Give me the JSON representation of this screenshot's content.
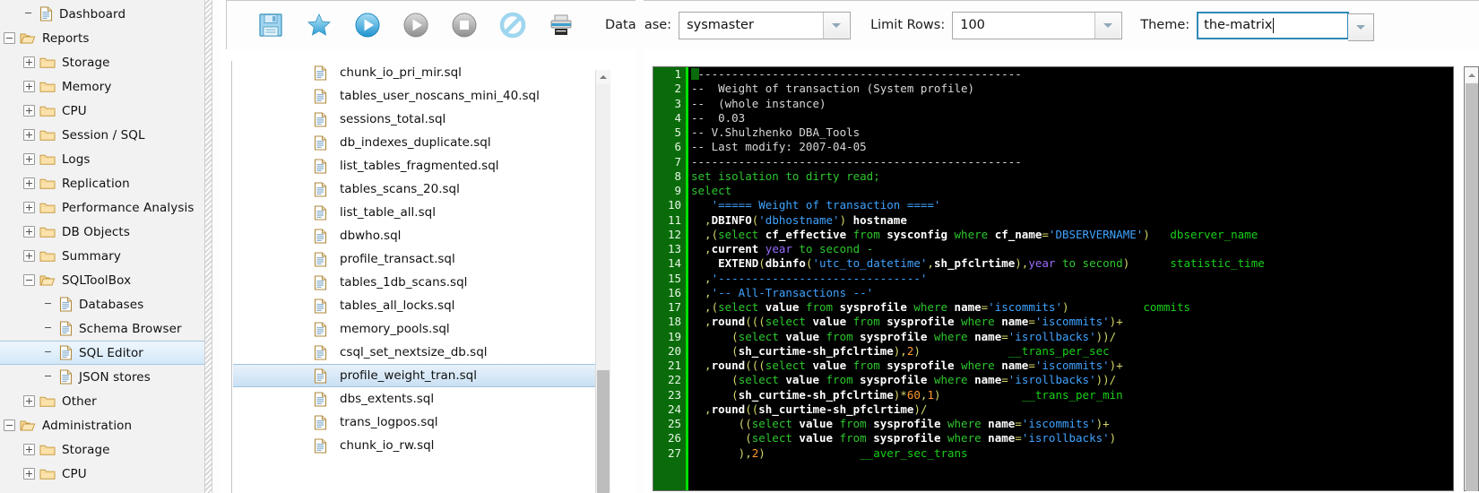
{
  "sidebar": {
    "items": [
      {
        "label": "Dashboard",
        "icon": "document-icon",
        "indent": 1,
        "expander": "none",
        "selected": false
      },
      {
        "label": "Reports",
        "icon": "folder-open-icon",
        "indent": 0,
        "expander": "minus",
        "selected": false
      },
      {
        "label": "Storage",
        "icon": "folder-icon",
        "indent": 1,
        "expander": "plus",
        "selected": false
      },
      {
        "label": "Memory",
        "icon": "folder-icon",
        "indent": 1,
        "expander": "plus",
        "selected": false
      },
      {
        "label": "CPU",
        "icon": "folder-icon",
        "indent": 1,
        "expander": "plus",
        "selected": false
      },
      {
        "label": "Session / SQL",
        "icon": "folder-icon",
        "indent": 1,
        "expander": "plus",
        "selected": false
      },
      {
        "label": "Logs",
        "icon": "folder-icon",
        "indent": 1,
        "expander": "plus",
        "selected": false
      },
      {
        "label": "Replication",
        "icon": "folder-icon",
        "indent": 1,
        "expander": "plus",
        "selected": false
      },
      {
        "label": "Performance Analysis",
        "icon": "folder-icon",
        "indent": 1,
        "expander": "plus",
        "selected": false
      },
      {
        "label": "DB Objects",
        "icon": "folder-icon",
        "indent": 1,
        "expander": "plus",
        "selected": false
      },
      {
        "label": "Summary",
        "icon": "folder-icon",
        "indent": 1,
        "expander": "plus",
        "selected": false
      },
      {
        "label": "SQLToolBox",
        "icon": "folder-open-icon",
        "indent": 1,
        "expander": "minus",
        "selected": false
      },
      {
        "label": "Databases",
        "icon": "document-icon",
        "indent": 2,
        "expander": "none",
        "selected": false
      },
      {
        "label": "Schema Browser",
        "icon": "document-icon",
        "indent": 2,
        "expander": "none",
        "selected": false
      },
      {
        "label": "SQL Editor",
        "icon": "document-icon",
        "indent": 2,
        "expander": "none",
        "selected": true
      },
      {
        "label": "JSON stores",
        "icon": "document-icon",
        "indent": 2,
        "expander": "none",
        "selected": false
      },
      {
        "label": "Other",
        "icon": "folder-icon",
        "indent": 1,
        "expander": "plus",
        "selected": false
      },
      {
        "label": "Administration",
        "icon": "folder-open-icon",
        "indent": 0,
        "expander": "minus",
        "selected": false
      },
      {
        "label": "Storage",
        "icon": "folder-icon",
        "indent": 1,
        "expander": "plus",
        "selected": false
      },
      {
        "label": "CPU",
        "icon": "folder-icon",
        "indent": 1,
        "expander": "plus",
        "selected": false
      }
    ]
  },
  "toolbar": {
    "buttons": [
      {
        "name": "save-icon",
        "title": "Save"
      },
      {
        "name": "favorite-star-icon",
        "title": "Favorite"
      },
      {
        "name": "run-icon",
        "title": "Run"
      },
      {
        "name": "run-step-icon",
        "title": "Run step"
      },
      {
        "name": "stop-icon",
        "title": "Stop"
      },
      {
        "name": "cancel-icon",
        "title": "Cancel"
      },
      {
        "name": "print-icon",
        "title": "Print"
      }
    ],
    "database": {
      "label": "Database:",
      "value": "sysmaster"
    },
    "limit_rows": {
      "label": "Limit Rows:",
      "value": "100"
    },
    "theme": {
      "label": "Theme:",
      "value": "the-matrix",
      "focused": true
    }
  },
  "filelist": {
    "files": [
      {
        "name": "chunk_io_pri_mir.sql",
        "selected": false
      },
      {
        "name": "tables_user_noscans_mini_40.sql",
        "selected": false
      },
      {
        "name": "sessions_total.sql",
        "selected": false
      },
      {
        "name": "db_indexes_duplicate.sql",
        "selected": false
      },
      {
        "name": "list_tables_fragmented.sql",
        "selected": false
      },
      {
        "name": "tables_scans_20.sql",
        "selected": false
      },
      {
        "name": "list_table_all.sql",
        "selected": false
      },
      {
        "name": "dbwho.sql",
        "selected": false
      },
      {
        "name": "profile_transact.sql",
        "selected": false
      },
      {
        "name": "tables_1db_scans.sql",
        "selected": false
      },
      {
        "name": "tables_all_locks.sql",
        "selected": false
      },
      {
        "name": "memory_pools.sql",
        "selected": false
      },
      {
        "name": "csql_set_nextsize_db.sql",
        "selected": false
      },
      {
        "name": "profile_weight_tran.sql",
        "selected": true
      },
      {
        "name": "dbs_extents.sql",
        "selected": false
      },
      {
        "name": "trans_logpos.sql",
        "selected": false
      },
      {
        "name": "chunk_io_rw.sql",
        "selected": false
      }
    ]
  },
  "editor": {
    "line_numbers": [
      1,
      2,
      3,
      4,
      5,
      6,
      7,
      8,
      9,
      10,
      11,
      12,
      13,
      14,
      15,
      16,
      17,
      18,
      19,
      20,
      21,
      22,
      23,
      24,
      25,
      26,
      27
    ],
    "lines": [
      [
        {
          "t": "-------------------------------------------------",
          "c": "cm"
        }
      ],
      [
        {
          "t": "--  Weight of transaction (System profile)",
          "c": "cm"
        }
      ],
      [
        {
          "t": "--  (whole instance)",
          "c": "cm"
        }
      ],
      [
        {
          "t": "--  0.03",
          "c": "cm"
        }
      ],
      [
        {
          "t": "-- V.Shulzhenko DBA_Tools",
          "c": "cm"
        }
      ],
      [
        {
          "t": "-- Last modify: 2007-04-05",
          "c": "cm"
        }
      ],
      [
        {
          "t": "-------------------------------------------------",
          "c": "cm"
        }
      ],
      [
        {
          "t": "set isolation to dirty read;",
          "c": "kw"
        }
      ],
      [
        {
          "t": "select",
          "c": "kw"
        }
      ],
      [
        {
          "t": "   ",
          "c": "cm"
        },
        {
          "t": "'===== Weight of transaction ===='",
          "c": "str"
        }
      ],
      [
        {
          "t": "  ,",
          "c": "op"
        },
        {
          "t": "DBINFO",
          "c": "fn"
        },
        {
          "t": "(",
          "c": "op"
        },
        {
          "t": "'dbhostname'",
          "c": "str"
        },
        {
          "t": ")",
          "c": "op"
        },
        {
          "t": " hostname",
          "c": "fn"
        }
      ],
      [
        {
          "t": "  ,(",
          "c": "op"
        },
        {
          "t": "select",
          "c": "kw"
        },
        {
          "t": " cf_effective ",
          "c": "fn"
        },
        {
          "t": "from",
          "c": "kw"
        },
        {
          "t": " sysconfig ",
          "c": "fn"
        },
        {
          "t": "where",
          "c": "kw"
        },
        {
          "t": " cf_name",
          "c": "fn"
        },
        {
          "t": "=",
          "c": "op"
        },
        {
          "t": "'DBSERVERNAME'",
          "c": "str"
        },
        {
          "t": ")",
          "c": "op"
        },
        {
          "t": "   ",
          "c": "cm"
        },
        {
          "t": "dbserver_name",
          "c": "al"
        }
      ],
      [
        {
          "t": "  ,",
          "c": "op"
        },
        {
          "t": "current ",
          "c": "fn"
        },
        {
          "t": "year",
          "c": "kw2"
        },
        {
          "t": " to second -",
          "c": "kw"
        }
      ],
      [
        {
          "t": "    ",
          "c": "cm"
        },
        {
          "t": "EXTEND",
          "c": "fn"
        },
        {
          "t": "(",
          "c": "op"
        },
        {
          "t": "dbinfo",
          "c": "fn"
        },
        {
          "t": "(",
          "c": "op"
        },
        {
          "t": "'utc_to_datetime'",
          "c": "str"
        },
        {
          "t": ",",
          "c": "op"
        },
        {
          "t": "sh_pfclrtime",
          "c": "fn"
        },
        {
          "t": "),",
          "c": "op"
        },
        {
          "t": "year",
          "c": "kw2"
        },
        {
          "t": " to second",
          "c": "kw"
        },
        {
          "t": ")",
          "c": "op"
        },
        {
          "t": "      ",
          "c": "cm"
        },
        {
          "t": "statistic_time",
          "c": "al"
        }
      ],
      [
        {
          "t": "  ,",
          "c": "op"
        },
        {
          "t": "'------------------------------'",
          "c": "str"
        }
      ],
      [
        {
          "t": "  ,",
          "c": "op"
        },
        {
          "t": "'-- All-Transactions --'",
          "c": "str"
        }
      ],
      [
        {
          "t": "  ,(",
          "c": "op"
        },
        {
          "t": "select",
          "c": "kw"
        },
        {
          "t": " value ",
          "c": "fn"
        },
        {
          "t": "from",
          "c": "kw"
        },
        {
          "t": " sysprofile ",
          "c": "fn"
        },
        {
          "t": "where",
          "c": "kw"
        },
        {
          "t": " name",
          "c": "fn"
        },
        {
          "t": "=",
          "c": "op"
        },
        {
          "t": "'iscommits'",
          "c": "str"
        },
        {
          "t": ")",
          "c": "op"
        },
        {
          "t": "           ",
          "c": "cm"
        },
        {
          "t": "commits",
          "c": "al"
        }
      ],
      [
        {
          "t": "  ,",
          "c": "op"
        },
        {
          "t": "round",
          "c": "fn"
        },
        {
          "t": "(((",
          "c": "op"
        },
        {
          "t": "select",
          "c": "kw"
        },
        {
          "t": " value ",
          "c": "fn"
        },
        {
          "t": "from",
          "c": "kw"
        },
        {
          "t": " sysprofile ",
          "c": "fn"
        },
        {
          "t": "where",
          "c": "kw"
        },
        {
          "t": " name",
          "c": "fn"
        },
        {
          "t": "=",
          "c": "op"
        },
        {
          "t": "'iscommits'",
          "c": "str"
        },
        {
          "t": ")+",
          "c": "op"
        }
      ],
      [
        {
          "t": "      (",
          "c": "op"
        },
        {
          "t": "select",
          "c": "kw"
        },
        {
          "t": " value ",
          "c": "fn"
        },
        {
          "t": "from",
          "c": "kw"
        },
        {
          "t": " sysprofile ",
          "c": "fn"
        },
        {
          "t": "where",
          "c": "kw"
        },
        {
          "t": " name",
          "c": "fn"
        },
        {
          "t": "=",
          "c": "op"
        },
        {
          "t": "'isrollbacks'",
          "c": "str"
        },
        {
          "t": "))/",
          "c": "op"
        }
      ],
      [
        {
          "t": "      (",
          "c": "op"
        },
        {
          "t": "sh_curtime-sh_pfclrtime",
          "c": "fn"
        },
        {
          "t": "),",
          "c": "op"
        },
        {
          "t": "2",
          "c": "num"
        },
        {
          "t": ")",
          "c": "op"
        },
        {
          "t": "             ",
          "c": "cm"
        },
        {
          "t": "__trans_per_sec",
          "c": "al"
        }
      ],
      [
        {
          "t": "  ,",
          "c": "op"
        },
        {
          "t": "round",
          "c": "fn"
        },
        {
          "t": "(((",
          "c": "op"
        },
        {
          "t": "select",
          "c": "kw"
        },
        {
          "t": " value ",
          "c": "fn"
        },
        {
          "t": "from",
          "c": "kw"
        },
        {
          "t": " sysprofile ",
          "c": "fn"
        },
        {
          "t": "where",
          "c": "kw"
        },
        {
          "t": " name",
          "c": "fn"
        },
        {
          "t": "=",
          "c": "op"
        },
        {
          "t": "'iscommits'",
          "c": "str"
        },
        {
          "t": ")+",
          "c": "op"
        }
      ],
      [
        {
          "t": "      (",
          "c": "op"
        },
        {
          "t": "select",
          "c": "kw"
        },
        {
          "t": " value ",
          "c": "fn"
        },
        {
          "t": "from",
          "c": "kw"
        },
        {
          "t": " sysprofile ",
          "c": "fn"
        },
        {
          "t": "where",
          "c": "kw"
        },
        {
          "t": " name",
          "c": "fn"
        },
        {
          "t": "=",
          "c": "op"
        },
        {
          "t": "'isrollbacks'",
          "c": "str"
        },
        {
          "t": "))/",
          "c": "op"
        }
      ],
      [
        {
          "t": "      (",
          "c": "op"
        },
        {
          "t": "sh_curtime-sh_pfclrtime",
          "c": "fn"
        },
        {
          "t": ")*",
          "c": "op"
        },
        {
          "t": "60",
          "c": "num"
        },
        {
          "t": ",",
          "c": "op"
        },
        {
          "t": "1",
          "c": "num"
        },
        {
          "t": ")",
          "c": "op"
        },
        {
          "t": "            ",
          "c": "cm"
        },
        {
          "t": "__trans_per_min",
          "c": "al"
        }
      ],
      [
        {
          "t": "  ,",
          "c": "op"
        },
        {
          "t": "round",
          "c": "fn"
        },
        {
          "t": "((",
          "c": "op"
        },
        {
          "t": "sh_curtime-sh_pfclrtime",
          "c": "fn"
        },
        {
          "t": ")/",
          "c": "op"
        }
      ],
      [
        {
          "t": "       ((",
          "c": "op"
        },
        {
          "t": "select",
          "c": "kw"
        },
        {
          "t": " value ",
          "c": "fn"
        },
        {
          "t": "from",
          "c": "kw"
        },
        {
          "t": " sysprofile ",
          "c": "fn"
        },
        {
          "t": "where",
          "c": "kw"
        },
        {
          "t": " name",
          "c": "fn"
        },
        {
          "t": "=",
          "c": "op"
        },
        {
          "t": "'iscommits'",
          "c": "str"
        },
        {
          "t": ")+",
          "c": "op"
        }
      ],
      [
        {
          "t": "        (",
          "c": "op"
        },
        {
          "t": "select",
          "c": "kw"
        },
        {
          "t": " value ",
          "c": "fn"
        },
        {
          "t": "from",
          "c": "kw"
        },
        {
          "t": " sysprofile ",
          "c": "fn"
        },
        {
          "t": "where",
          "c": "kw"
        },
        {
          "t": " name",
          "c": "fn"
        },
        {
          "t": "=",
          "c": "op"
        },
        {
          "t": "'isrollbacks'",
          "c": "str"
        },
        {
          "t": ")",
          "c": "op"
        }
      ],
      [
        {
          "t": "       ),",
          "c": "op"
        },
        {
          "t": "2",
          "c": "num"
        },
        {
          "t": ")",
          "c": "op"
        },
        {
          "t": "              ",
          "c": "cm"
        },
        {
          "t": "__aver_sec_trans",
          "c": "al"
        }
      ]
    ]
  },
  "colors": {
    "gutter_green": "#0a6b0a",
    "gutter_edge": "#00e000",
    "editor_bg": "#000000",
    "keyword": "#2ec62e",
    "string": "#3fa3ff",
    "alias": "#18d018",
    "number": "#ff9a2e",
    "focus_border": "#2f89b5",
    "selection": "#c9e0f4"
  }
}
